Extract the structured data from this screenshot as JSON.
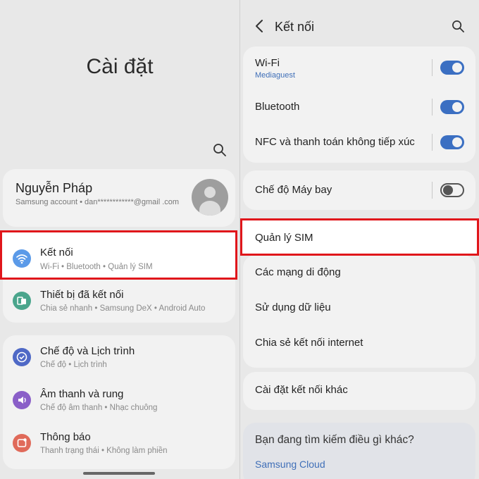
{
  "left": {
    "title": "Cài đặt",
    "account": {
      "name": "Nguyễn Pháp",
      "subtitle": "Samsung account • dan************@gmail .com"
    },
    "items": [
      {
        "title": "Kết nối",
        "subtitle": "Wi-Fi • Bluetooth • Quản lý SIM",
        "icon": "wifi-icon",
        "color": "#5b9ae8"
      },
      {
        "title": "Thiết bị đã kết nối",
        "subtitle": "Chia sẻ nhanh • Samsung DeX • Android Auto",
        "icon": "connected-devices-icon",
        "color": "#4aa58c"
      },
      {
        "title": "Chế độ và Lịch trình",
        "subtitle": "Chế độ • Lịch trình",
        "icon": "check-circle-icon",
        "color": "#4f69c6"
      },
      {
        "title": "Âm thanh và rung",
        "subtitle": "Chế độ âm thanh • Nhạc chuông",
        "icon": "volume-icon",
        "color": "#8a5fc8"
      },
      {
        "title": "Thông báo",
        "subtitle": "Thanh trạng thái • Không làm phiền",
        "icon": "notification-icon",
        "color": "#e06a5a"
      }
    ]
  },
  "right": {
    "title": "Kết nối",
    "wifi": {
      "label": "Wi-Fi",
      "network": "Mediaguest",
      "on": true
    },
    "bluetooth": {
      "label": "Bluetooth",
      "on": true
    },
    "nfc": {
      "label": "NFC và thanh toán không tiếp xúc",
      "on": true
    },
    "airplane": {
      "label": "Chế độ Máy bay",
      "on": false
    },
    "sim": {
      "label": "Quản lý SIM"
    },
    "mobile_networks": {
      "label": "Các mạng di động"
    },
    "data_usage": {
      "label": "Sử dụng dữ liệu"
    },
    "hotspot": {
      "label": "Chia sẻ kết nối internet"
    },
    "more": {
      "label": "Cài đặt kết nối khác"
    },
    "looking": {
      "text": "Bạn đang tìm kiếm điều gì khác?",
      "link": "Samsung Cloud"
    }
  },
  "colors": {
    "highlight": "#e0161b",
    "accent": "#3b6fc2",
    "link": "#3f6fb8"
  }
}
